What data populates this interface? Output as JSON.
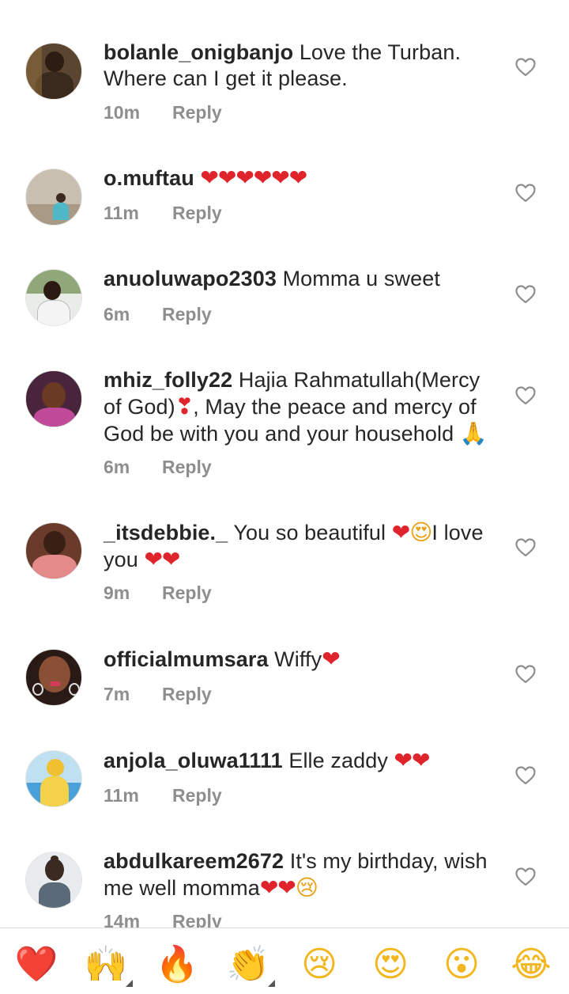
{
  "comments": [
    {
      "username": "bolanle_onigbanjo",
      "text": " Love the Turban. Where can I get it please.",
      "time": "10m",
      "reply": "Reply"
    },
    {
      "username": "o.muftau",
      "text": " ",
      "emoji": "❤❤❤❤❤❤",
      "time": "11m",
      "reply": "Reply"
    },
    {
      "username": "anuoluwapo2303",
      "text": " Momma u sweet",
      "time": "6m",
      "reply": "Reply"
    },
    {
      "username": "mhiz_folly22",
      "text_a": " Hajia Rahmatullah(Mercy of God)",
      "emoji_a": "❣",
      "text_b": ", May the peace and mercy of God be with you and your household ",
      "emoji_b": "🙏",
      "time": "6m",
      "reply": "Reply"
    },
    {
      "username": "_itsdebbie._",
      "text_a": " You so beautiful ",
      "emoji_a": "❤",
      "emoji_face": "😍",
      "text_b": "I love you ",
      "emoji_b": "❤❤",
      "time": "9m",
      "reply": "Reply"
    },
    {
      "username": "officialmumsara",
      "text": " Wiffy",
      "emoji": "❤",
      "time": "7m",
      "reply": "Reply"
    },
    {
      "username": "anjola_oluwa1111",
      "text": " Elle zaddy ",
      "emoji": "❤❤",
      "time": "11m",
      "reply": "Reply"
    },
    {
      "username": "abdulkareem2672",
      "text": " It's  my birthday, wish me well momma",
      "emoji": "❤❤",
      "emoji_face": "😢",
      "time": "14m",
      "reply": "Reply"
    }
  ],
  "reactions": [
    "❤️",
    "🙌",
    "🔥",
    "👏",
    "😢",
    "😍",
    "😮",
    "😂"
  ],
  "colors": {
    "text": "#262626",
    "meta": "#8e8e8e",
    "heart_red": "#e0242b",
    "divider": "#dbdbdb"
  },
  "icons": {
    "like": "heart-outline-icon"
  }
}
